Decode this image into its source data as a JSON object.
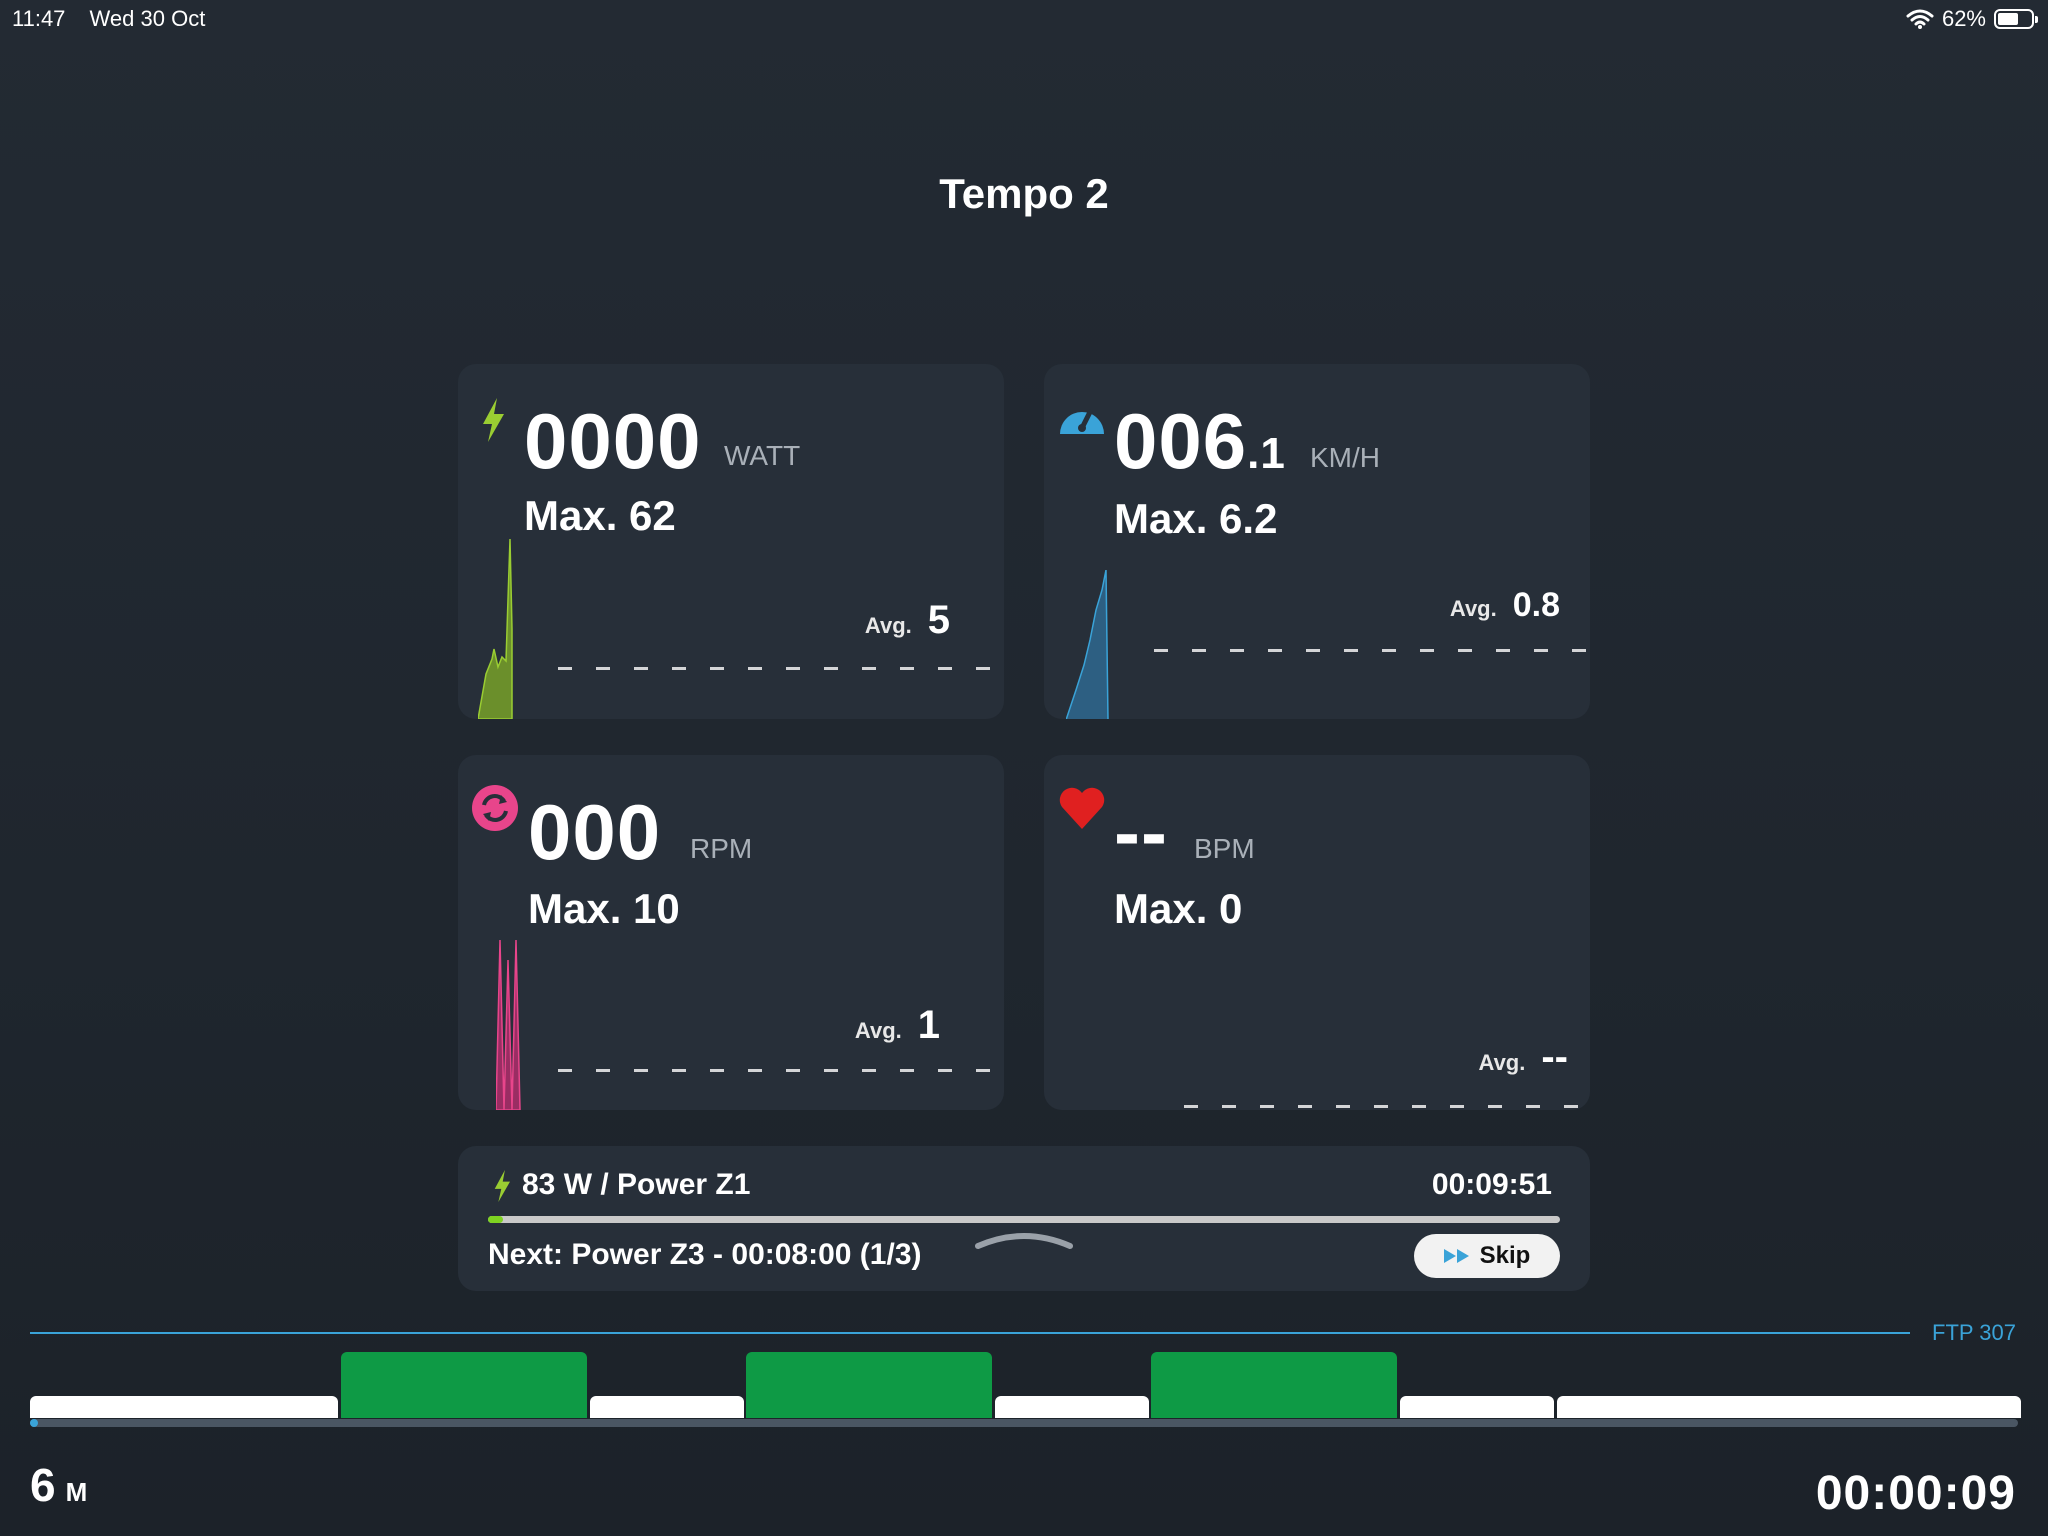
{
  "status_bar": {
    "time": "11:47",
    "date": "Wed 30 Oct",
    "battery": "62%",
    "battery_level": 0.62
  },
  "workout": {
    "title": "Tempo 2"
  },
  "tiles": {
    "power": {
      "value": "0000",
      "unit": "WATT",
      "max": "Max. 62",
      "avg_label": "Avg.",
      "avg": "5",
      "color": "#9acd32",
      "icon": "lightning-bolt-icon"
    },
    "speed": {
      "value_main": "006",
      "value_decimal": ".1",
      "unit": "KM/H",
      "max": "Max. 6.2",
      "avg_label": "Avg.",
      "avg": "0.8",
      "color": "#3aa3d8",
      "icon": "speedometer-icon"
    },
    "cadence": {
      "value": "000",
      "unit": "RPM",
      "max": "Max. 10",
      "avg_label": "Avg.",
      "avg": "1",
      "color": "#e8458b",
      "icon": "cadence-cycle-icon"
    },
    "heart_rate": {
      "value": "--",
      "unit": "BPM",
      "max": "Max. 0",
      "avg_label": "Avg.",
      "avg": "--",
      "color": "#e02020",
      "icon": "heart-icon"
    }
  },
  "interval": {
    "current": "83 W / Power Z1",
    "remaining": "00:09:51",
    "progress": 0.014,
    "next": "Next: Power Z3 - 00:08:00 (1/3)",
    "skip_label": "Skip"
  },
  "timeline": {
    "ftp_label": "FTP 307",
    "progress": 0.003,
    "blocks": [
      "low",
      "high",
      "low",
      "high",
      "low",
      "high",
      "low",
      "low"
    ]
  },
  "footer": {
    "distance": "6",
    "distance_unit": "M",
    "elapsed": "00:00:09"
  }
}
